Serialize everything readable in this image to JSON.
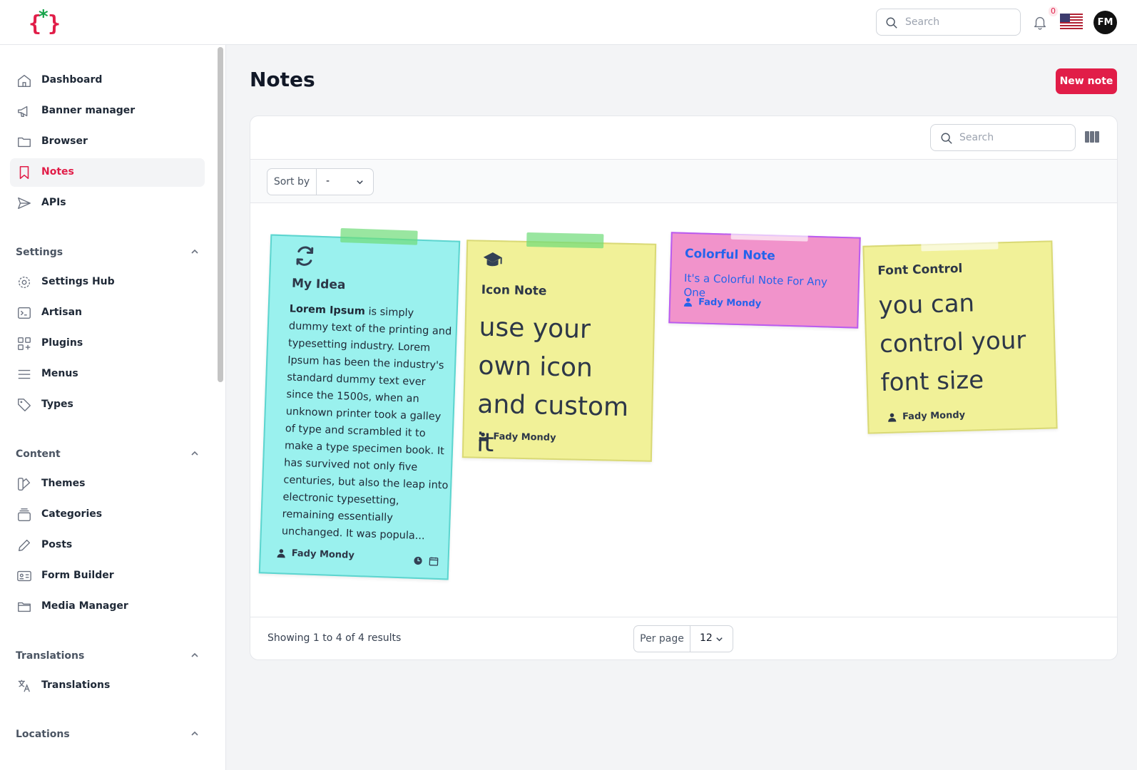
{
  "app": {
    "search_placeholder": "Search",
    "notification_count": "0",
    "user_initials": "FM"
  },
  "sidebar": {
    "main_items": [
      {
        "label": "Dashboard",
        "icon": "home-icon",
        "active": false
      },
      {
        "label": "Banner manager",
        "icon": "megaphone-icon",
        "active": false
      },
      {
        "label": "Browser",
        "icon": "folder-icon",
        "active": false
      },
      {
        "label": "Notes",
        "icon": "bookmark-icon",
        "active": true
      },
      {
        "label": "APIs",
        "icon": "send-icon",
        "active": false
      }
    ],
    "groups": [
      {
        "label": "Settings",
        "items": [
          {
            "label": "Settings Hub",
            "icon": "gear-icon"
          },
          {
            "label": "Artisan",
            "icon": "terminal-icon"
          },
          {
            "label": "Plugins",
            "icon": "grid-plus-icon"
          },
          {
            "label": "Menus",
            "icon": "menu-lines-icon"
          },
          {
            "label": "Types",
            "icon": "tag-icon"
          }
        ]
      },
      {
        "label": "Content",
        "items": [
          {
            "label": "Themes",
            "icon": "swatch-icon"
          },
          {
            "label": "Categories",
            "icon": "stack-icon"
          },
          {
            "label": "Posts",
            "icon": "pencil-icon"
          },
          {
            "label": "Form Builder",
            "icon": "id-card-icon"
          },
          {
            "label": "Media Manager",
            "icon": "folder-icon"
          }
        ]
      },
      {
        "label": "Translations",
        "items": [
          {
            "label": "Translations",
            "icon": "language-icon"
          }
        ]
      },
      {
        "label": "Locations",
        "items": []
      }
    ]
  },
  "page": {
    "title": "Notes",
    "new_note_label": "New note",
    "search_placeholder": "Search",
    "sort_label": "Sort by",
    "sort_value": "-",
    "showing_text": "Showing 1 to 4 of 4 results",
    "per_page_label": "Per page",
    "per_page_value": "12"
  },
  "notes": [
    {
      "title": "My Idea",
      "icon": "refresh-icon",
      "body_bold": "Lorem Ipsum",
      "body": " is simply dummy text of the printing and typesetting industry. Lorem Ipsum has been the industry's standard dummy text ever since the 1500s, when an unknown printer took a galley of type and scrambled it to make a type specimen book. It has survived not only five centuries, but also the leap into electronic typesetting, remaining essentially unchanged. It was popula...",
      "author": "Fady Mondy",
      "bg": "#9af1ee",
      "border": "#5dd5cf"
    },
    {
      "title": "Icon Note",
      "icon": "graduation-cap-icon",
      "body": "use your own icon and custom it",
      "author": "Fady Mondy",
      "bg": "#f1f198",
      "border": "#d9d976"
    },
    {
      "title": "Colorful Note",
      "body": "It's a Colorful Note For Any One",
      "author": "Fady Mondy",
      "bg": "#f193cb",
      "border": "#b95cf0",
      "text_color": "#2563eb"
    },
    {
      "title": "Font Control",
      "body": "you can control your font size",
      "author": "Fady Mondy",
      "bg": "#f1f198",
      "border": "#d9d976"
    }
  ]
}
